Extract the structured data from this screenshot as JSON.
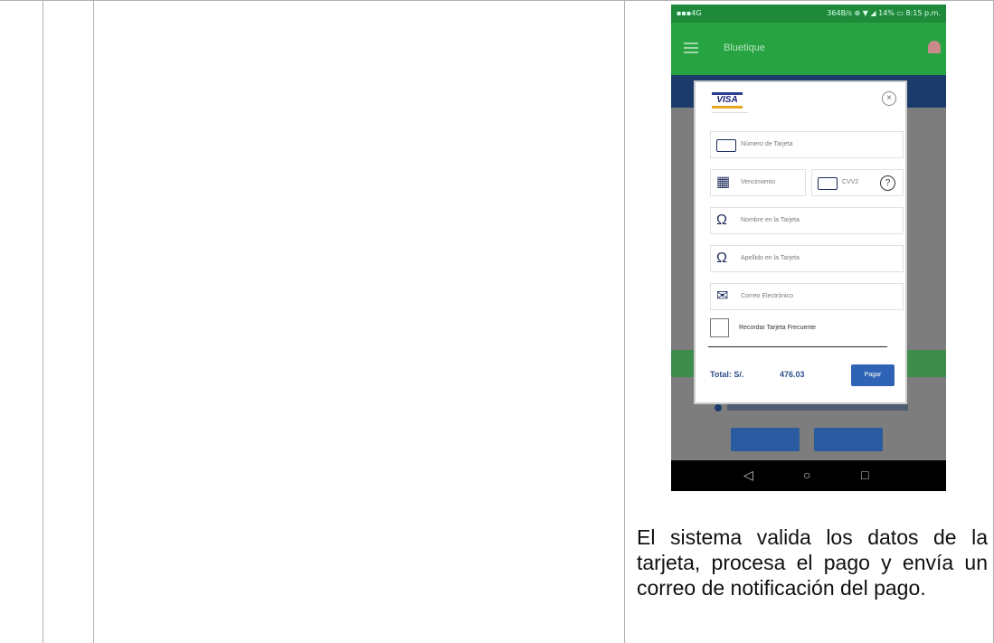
{
  "phone": {
    "status_left": "▪▪▪4G",
    "status_right": "364B/s ⊕ ▼ ◢ 14% ▭ 8:15 p.m.",
    "app_title": "Bluetique",
    "dialog": {
      "brand": "VISA",
      "close_glyph": "×",
      "card_number_placeholder": "Número de Tarjeta",
      "expiry_placeholder": "Vencimiento",
      "cvv_placeholder": "CVV2",
      "help_glyph": "?",
      "first_name_placeholder": "Nombre en la Tarjeta",
      "last_name_placeholder": "Apellido en la Tarjeta",
      "email_placeholder": "Correo Electrónico",
      "remember_label": "Recordar Tarjeta Frecuente",
      "total_label": "Total: S/.",
      "total_amount": "476.03",
      "pay_label": "Pagar"
    },
    "nav": {
      "back": "◁",
      "home": "○",
      "recent": "□"
    }
  },
  "description": "El sistema valida los datos de la tarjeta, procesa el pago y envía un correo de notificación del pago."
}
